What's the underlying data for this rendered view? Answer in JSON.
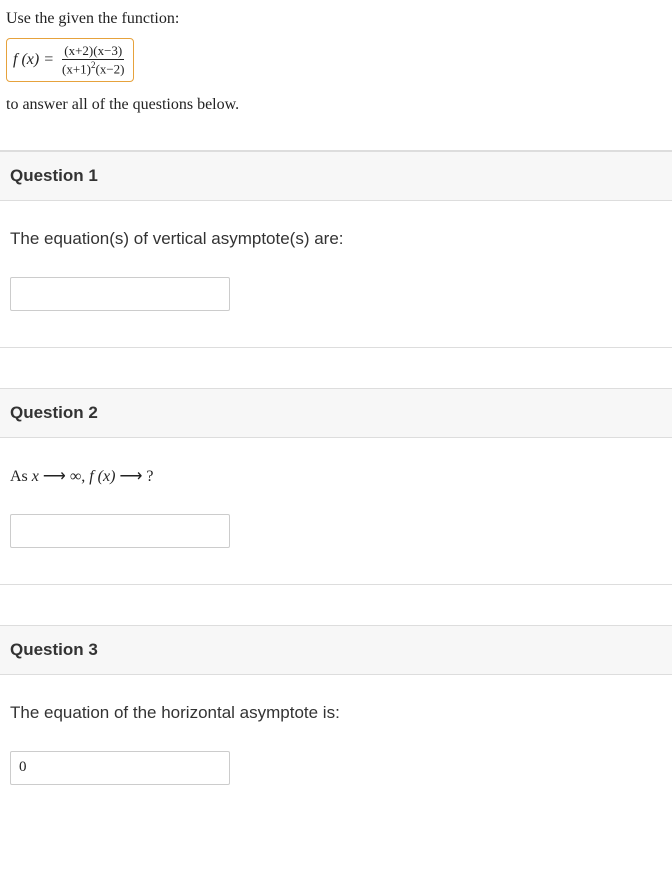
{
  "intro": {
    "line1": "Use the given the function:",
    "func_lhs": "f (x) =",
    "func_num": "(x+2)(x−3)",
    "func_den_a": "(x+1)",
    "func_den_exp": "2",
    "func_den_b": "(x−2)",
    "line2": "to answer all of the questions below."
  },
  "questions": [
    {
      "header": "Question 1",
      "prompt": "The equation(s) of vertical asymptote(s) are:",
      "prompt_style": "sans",
      "value": "",
      "placeholder": ""
    },
    {
      "header": "Question 2",
      "prompt_parts": {
        "prefix": "As ",
        "x": "x",
        "arrow1": "  ⟶  ∞,  ",
        "fx": "f (x)",
        "arrow2": "  ⟶ ?"
      },
      "prompt_style": "serif",
      "value": "",
      "placeholder": ""
    },
    {
      "header": "Question 3",
      "prompt": "The equation of the horizontal asymptote is:",
      "prompt_style": "sans",
      "value": "0",
      "placeholder": ""
    }
  ]
}
